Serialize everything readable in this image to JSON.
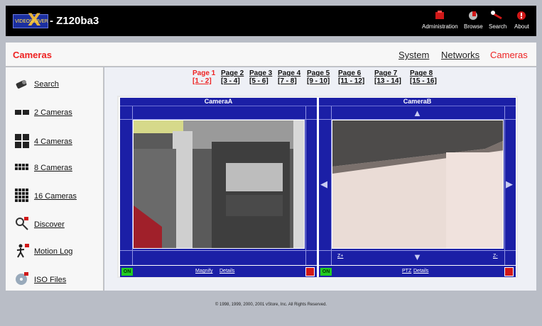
{
  "header": {
    "logo_text": "VIDEOSERVER",
    "device_name": "- Z120ba3",
    "items": [
      {
        "label": "Administration",
        "icon": "administration-icon"
      },
      {
        "label": "Browse",
        "icon": "browse-icon"
      },
      {
        "label": "Search",
        "icon": "search-icon"
      },
      {
        "label": "About",
        "icon": "about-icon"
      }
    ]
  },
  "nav": {
    "title": "Cameras",
    "links": [
      "System",
      "Networks",
      "Cameras"
    ]
  },
  "sidebar": {
    "items": [
      {
        "label": "Search",
        "icon": "search-camera-icon"
      },
      {
        "label": "2 Cameras",
        "icon": "two-cameras-icon"
      },
      {
        "label": "4 Cameras",
        "icon": "four-cameras-icon"
      },
      {
        "label": "8 Cameras",
        "icon": "eight-cameras-icon"
      },
      {
        "label": "16 Cameras",
        "icon": "sixteen-cameras-icon"
      },
      {
        "label": "Discover",
        "icon": "discover-icon"
      },
      {
        "label": "Motion Log",
        "icon": "motion-log-icon"
      },
      {
        "label": "ISO Files",
        "icon": "iso-files-icon"
      }
    ]
  },
  "pager": [
    {
      "page": "Page 1",
      "range": "[1 - 2]",
      "active": true
    },
    {
      "page": "Page 2",
      "range": "[3 - 4]"
    },
    {
      "page": "Page 3",
      "range": "[5 - 6]"
    },
    {
      "page": "Page 4",
      "range": "[7 - 8]"
    },
    {
      "page": "Page 5",
      "range": "[9 - 10]"
    },
    {
      "page": "Page 6",
      "range": "[11 - 12]"
    },
    {
      "page": "Page 7",
      "range": "[13 - 14]"
    },
    {
      "page": "Page 8",
      "range": "[15 - 16]"
    }
  ],
  "cameras": [
    {
      "name": "CameraA",
      "status": "ON",
      "buttons": [
        "Magnify",
        "Details"
      ]
    },
    {
      "name": "CameraB",
      "status": "ON",
      "buttons": [
        "PTZ",
        "Details"
      ],
      "zoom_in": "Z+",
      "zoom_out": "Z-"
    }
  ],
  "footer": {
    "copyright": "© 1998, 1999, 2000, 2001 vStore, Inc. All Rights Reserved."
  },
  "colors": {
    "accent_red": "#ee2222",
    "panel_blue": "#1b1fa6",
    "on_green": "#22cc22"
  }
}
